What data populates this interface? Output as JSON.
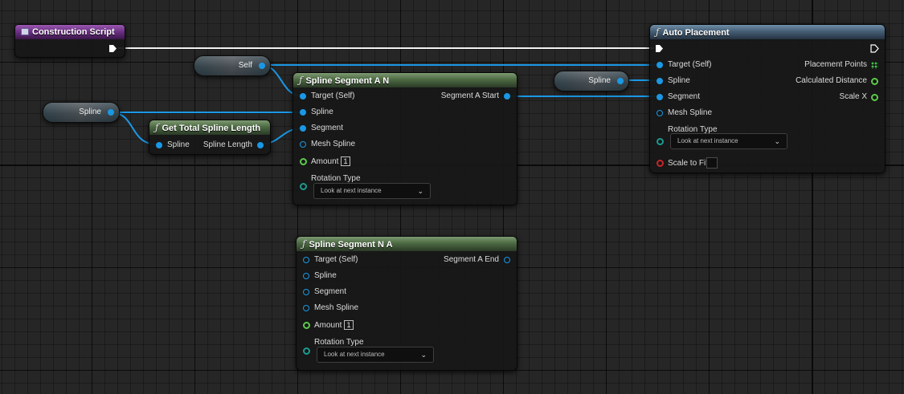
{
  "construction_script": {
    "title": "Construction Script",
    "header_color": "#6a2e82"
  },
  "var_self": {
    "label": "Self"
  },
  "var_spline_left": {
    "label": "Spline"
  },
  "var_spline_right": {
    "label": "Spline"
  },
  "get_total_spline_length": {
    "title": "Get Total Spline Length",
    "input_spline": "Spline",
    "output_length": "Spline Length"
  },
  "spline_segment_an": {
    "title": "Spline Segment A N",
    "inputs": {
      "target": "Target (Self)",
      "spline": "Spline",
      "segment": "Segment",
      "mesh_spline": "Mesh Spline",
      "amount": "Amount",
      "amount_value": "1",
      "rotation_type": "Rotation Type",
      "rotation_value": "Look at next instance"
    },
    "output": "Segment A Start"
  },
  "spline_segment_na": {
    "title": "Spline Segment N A",
    "inputs": {
      "target": "Target (Self)",
      "spline": "Spline",
      "segment": "Segment",
      "mesh_spline": "Mesh Spline",
      "amount": "Amount",
      "amount_value": "1",
      "rotation_type": "Rotation Type",
      "rotation_value": "Look at next instance"
    },
    "output": "Segment A End"
  },
  "auto_placement": {
    "title": "Auto Placement",
    "inputs": {
      "target": "Target (Self)",
      "spline": "Spline",
      "segment": "Segment",
      "mesh_spline": "Mesh Spline",
      "rotation_type": "Rotation Type",
      "rotation_value": "Look at next instance",
      "scale_to_fit": "Scale to Fit"
    },
    "outputs": {
      "placement_points": "Placement Points",
      "calculated_distance": "Calculated Distance",
      "scale_x": "Scale X"
    }
  },
  "colors": {
    "object_pin": "#1a98e6",
    "float_pin": "#5ec94c",
    "bool_pin": "#c8262a",
    "function_header": "#4d6a43",
    "exec_wire": "#ffffff"
  }
}
